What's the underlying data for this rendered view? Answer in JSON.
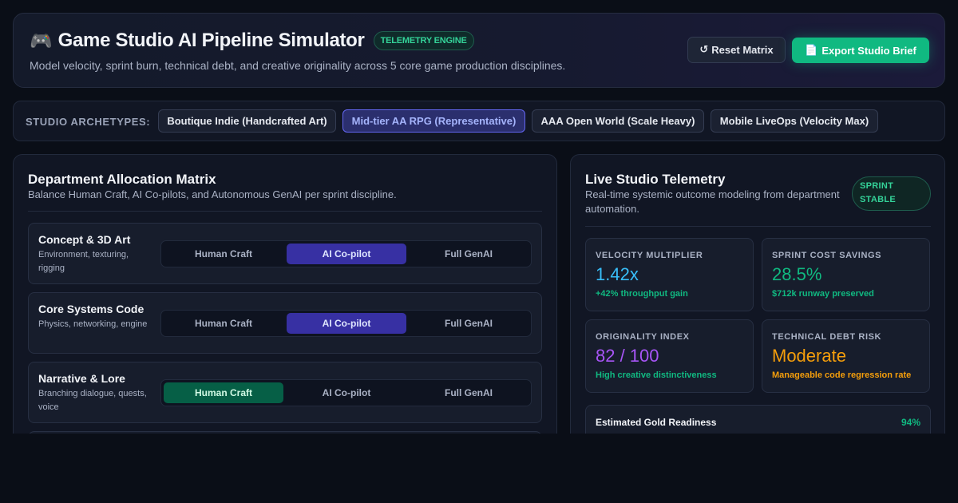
{
  "header": {
    "icon": "gamepad-icon",
    "icon_glyph": "🎮",
    "title": "Game Studio AI Pipeline Simulator",
    "badge": "TELEMETRY ENGINE",
    "subtitle": "Model velocity, sprint burn, technical debt, and creative originality across 5 core game production disciplines.",
    "reset_icon": "↺",
    "reset_label": "Reset Matrix",
    "export_icon": "📄",
    "export_label": "Export Studio Brief"
  },
  "archetypes": {
    "label": "STUDIO ARCHETYPES:",
    "options": [
      {
        "label": "Boutique Indie (Handcrafted Art)",
        "active": false
      },
      {
        "label": "Mid-tier AA RPG (Representative)",
        "active": true
      },
      {
        "label": "AAA Open World (Scale Heavy)",
        "active": false
      },
      {
        "label": "Mobile LiveOps (Velocity Max)",
        "active": false
      }
    ]
  },
  "matrix": {
    "title": "Department Allocation Matrix",
    "subtitle": "Balance Human Craft, AI Co-pilots, and Autonomous GenAI per sprint discipline.",
    "options": [
      "Human Craft",
      "AI Co-pilot",
      "Full GenAI"
    ],
    "departments": [
      {
        "name": "Concept & 3D Art",
        "description": "Environment, texturing, rigging",
        "selected": "AI Co-pilot"
      },
      {
        "name": "Core Systems Code",
        "description": "Physics, networking, engine",
        "selected": "AI Co-pilot"
      },
      {
        "name": "Narrative & Lore",
        "description": "Branching dialogue, quests, voice",
        "selected": "Human Craft"
      }
    ]
  },
  "telemetry": {
    "title": "Live Studio Telemetry",
    "subtitle": "Real-time systemic outcome modeling from department automation.",
    "status_badge": "SPRINT STABLE",
    "metrics": [
      {
        "label": "VELOCITY MULTIPLIER",
        "value": "1.42x",
        "note": "+42% throughput gain",
        "value_color": "#38bdf8",
        "note_color": "#10b981"
      },
      {
        "label": "SPRINT COST SAVINGS",
        "value": "28.5%",
        "note": "$712k runway preserved",
        "value_color": "#10b981",
        "note_color": "#10b981"
      },
      {
        "label": "ORIGINALITY INDEX",
        "value": "82 / 100",
        "note": "High creative distinctiveness",
        "value_color": "#a855f7",
        "note_color": "#10b981"
      },
      {
        "label": "TECHNICAL DEBT RISK",
        "value": "Moderate",
        "note": "Manageable code regression rate",
        "value_color": "#f59e0b",
        "note_color": "#f59e0b"
      }
    ],
    "gold_label": "Estimated Gold Readiness",
    "gold_value": "94%"
  }
}
